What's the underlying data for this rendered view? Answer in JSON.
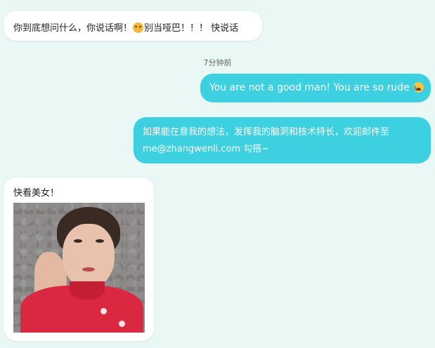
{
  "messages": {
    "msg1": {
      "text_before": "你到底想问什么，你说话啊！",
      "emoji": "angry-face-icon",
      "text_after": "别当哑巴！！！ 快说话"
    },
    "timestamp": "7分钟前",
    "msg2": {
      "text": "You are not a good man! You are so rude",
      "emoji": "crying-face-icon"
    },
    "msg3": {
      "line1": "如果能在意我的想法，发挥我的脑洞和技术特长，欢迎邮件至",
      "line2": "me@zhangwenli.com 勾搭~"
    },
    "msg4": {
      "caption": "快看美女！"
    }
  },
  "colors": {
    "background": "#e9f7f5",
    "outgoing_bubble": "#3cd0e0",
    "incoming_bubble": "#ffffff"
  }
}
